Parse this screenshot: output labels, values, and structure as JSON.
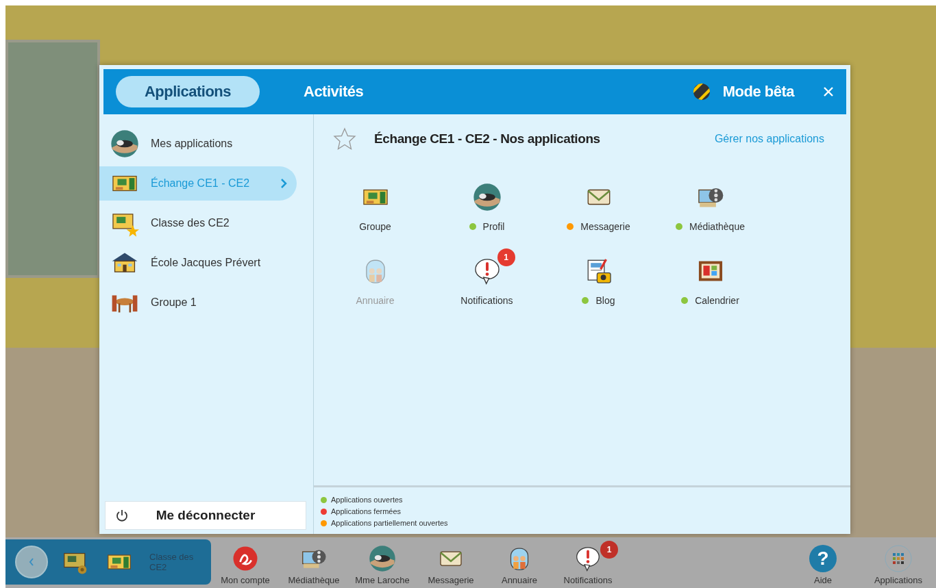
{
  "header": {
    "tabs": [
      {
        "label": "Applications",
        "selected": true
      },
      {
        "label": "Activités",
        "selected": false
      }
    ],
    "beta": "Mode bêta"
  },
  "sidebar": {
    "items": [
      {
        "label": "Mes applications",
        "kind": "avatar",
        "selected": false
      },
      {
        "label": "Échange CE1 - CE2",
        "kind": "room",
        "selected": true
      },
      {
        "label": "Classe des CE2",
        "kind": "room-star",
        "selected": false
      },
      {
        "label": "École Jacques Prévert",
        "kind": "school",
        "selected": false
      },
      {
        "label": "Groupe 1",
        "kind": "table",
        "selected": false
      }
    ],
    "logout": "Me déconnecter"
  },
  "content": {
    "title": "Échange CE1 - CE2 - Nos applications",
    "manage_link": "Gérer nos applications",
    "apps": [
      {
        "name": "Groupe",
        "kind": "room",
        "disabled": false
      },
      {
        "name": "Profil",
        "kind": "avatar",
        "color": "#8dc63f",
        "disabled": false
      },
      {
        "name": "Messagerie",
        "kind": "envelope",
        "color": "#ff9900",
        "disabled": false
      },
      {
        "name": "Médiathèque",
        "kind": "film",
        "color": "#8dc63f",
        "disabled": false
      },
      {
        "name": "Annuaire",
        "kind": "people",
        "disabled": true
      },
      {
        "name": "Notifications",
        "kind": "alert",
        "badge": "1",
        "disabled": false
      },
      {
        "name": "Blog",
        "kind": "blog",
        "color": "#8dc63f",
        "disabled": false
      },
      {
        "name": "Calendrier",
        "kind": "calendar",
        "color": "#8dc63f",
        "disabled": false
      }
    ],
    "legend": [
      {
        "color": "#8dc63f",
        "label": "Applications ouvertes"
      },
      {
        "color": "#ee3b33",
        "label": "Applications fermées"
      },
      {
        "color": "#ff9900",
        "label": "Applications partiellement ouvertes"
      }
    ]
  },
  "taskbar": {
    "class_label": "Classe des CE2",
    "items": [
      {
        "label": "Mon compte",
        "kind": "account"
      },
      {
        "label": "Médiathèque",
        "kind": "film"
      },
      {
        "label": "Mme Laroche",
        "kind": "avatar"
      },
      {
        "label": "Messagerie",
        "kind": "envelope"
      },
      {
        "label": "Annuaire",
        "kind": "people"
      },
      {
        "label": "Notifications",
        "kind": "alert",
        "badge": "1"
      }
    ],
    "help": {
      "glyph": "?",
      "label": "Aide"
    },
    "apps_label": "Applications"
  }
}
